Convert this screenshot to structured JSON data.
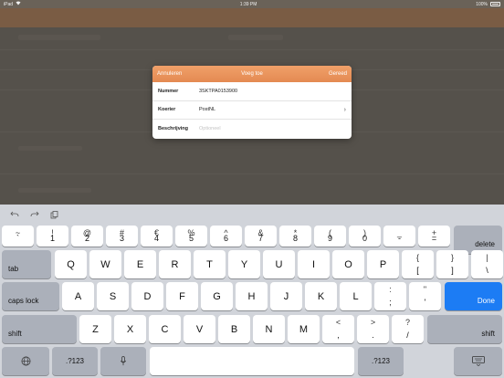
{
  "statusbar": {
    "device": "iPad",
    "time": "1:39 PM",
    "battery": "100%"
  },
  "modal": {
    "cancel": "Annuleren",
    "title": "Voeg toe",
    "done": "Gereed",
    "rows": [
      {
        "label": "Nummer",
        "value": "3SKTPA0153900"
      },
      {
        "label": "Koerier",
        "value": "PostNL"
      },
      {
        "label": "Beschrijving",
        "placeholder": "Optioneel"
      }
    ]
  },
  "keyboard": {
    "toolbar": {
      "undo_icon": "undo-icon",
      "redo_icon": "redo-icon",
      "paste_icon": "paste-icon"
    },
    "row1": [
      {
        "top": "~",
        "bot": "`"
      },
      {
        "top": "!",
        "bot": "1"
      },
      {
        "top": "@",
        "bot": "2"
      },
      {
        "top": "#",
        "bot": "3"
      },
      {
        "top": "€",
        "bot": "4"
      },
      {
        "top": "%",
        "bot": "5"
      },
      {
        "top": "^",
        "bot": "6"
      },
      {
        "top": "&",
        "bot": "7"
      },
      {
        "top": "*",
        "bot": "8"
      },
      {
        "top": "(",
        "bot": "9"
      },
      {
        "top": ")",
        "bot": "0"
      },
      {
        "top": "_",
        "bot": "-"
      },
      {
        "top": "+",
        "bot": "="
      }
    ],
    "delete": "delete",
    "tab": "tab",
    "row2": [
      "Q",
      "W",
      "E",
      "R",
      "T",
      "Y",
      "U",
      "I",
      "O",
      "P"
    ],
    "row2_extra": [
      {
        "top": "{",
        "bot": "["
      },
      {
        "top": "}",
        "bot": "]"
      },
      {
        "top": "|",
        "bot": "\\"
      }
    ],
    "capslock": "caps lock",
    "row3": [
      "A",
      "S",
      "D",
      "F",
      "G",
      "H",
      "J",
      "K",
      "L"
    ],
    "row3_extra": [
      {
        "top": ":",
        "bot": ";"
      },
      {
        "top": "\"",
        "bot": "'"
      }
    ],
    "done": "Done",
    "shift": "shift",
    "row4": [
      "Z",
      "X",
      "C",
      "V",
      "B",
      "N",
      "M"
    ],
    "row4_extra": [
      {
        "top": "<",
        "bot": ","
      },
      {
        "top": ">",
        "bot": "."
      },
      {
        "top": "?",
        "bot": "/"
      }
    ],
    "numbers_label": ".?123",
    "globe_icon": "globe-icon",
    "mic_icon": "microphone-icon",
    "hide_icon": "keyboard-hide-icon"
  }
}
